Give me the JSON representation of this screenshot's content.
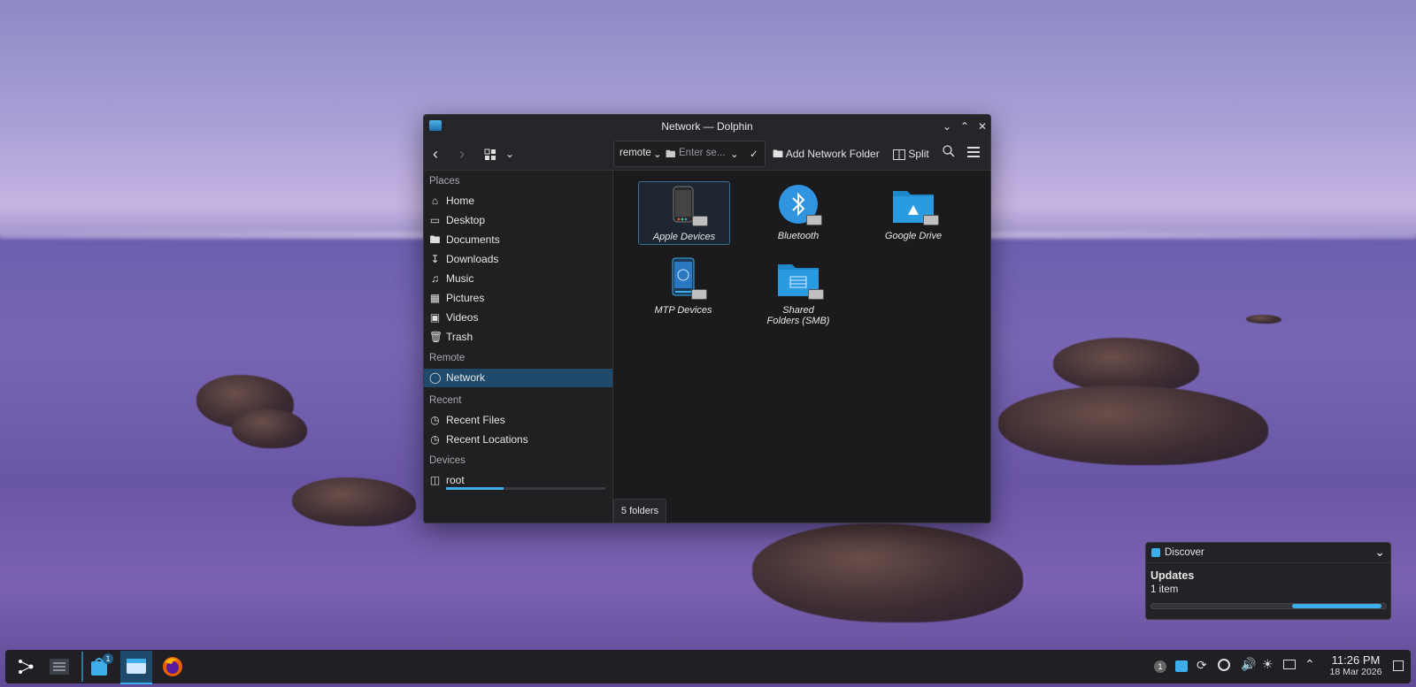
{
  "window": {
    "title": "Network — Dolphin"
  },
  "toolbar": {
    "breadcrumb_root": "remote",
    "location_placeholder": "Enter se...",
    "add_network_folder": "Add Network Folder",
    "split": "Split"
  },
  "sidebar": {
    "sections": [
      {
        "title": "Places"
      },
      {
        "title": "Remote"
      },
      {
        "title": "Recent"
      },
      {
        "title": "Devices"
      }
    ],
    "places": [
      {
        "label": "Home",
        "icon": "home-icon"
      },
      {
        "label": "Desktop",
        "icon": "desktop-icon"
      },
      {
        "label": "Documents",
        "icon": "documents-icon"
      },
      {
        "label": "Downloads",
        "icon": "downloads-icon"
      },
      {
        "label": "Music",
        "icon": "music-icon"
      },
      {
        "label": "Pictures",
        "icon": "pictures-icon"
      },
      {
        "label": "Videos",
        "icon": "videos-icon"
      },
      {
        "label": "Trash",
        "icon": "trash-icon"
      }
    ],
    "remote": [
      {
        "label": "Network",
        "icon": "network-icon",
        "active": true
      }
    ],
    "recent": [
      {
        "label": "Recent Files",
        "icon": "recent-files-icon"
      },
      {
        "label": "Recent Locations",
        "icon": "recent-locations-icon"
      }
    ],
    "devices": [
      {
        "label": "root",
        "icon": "drive-icon",
        "usage": 0.36
      }
    ]
  },
  "folders": [
    {
      "name": "Apple Devices",
      "icon": "phone-icon",
      "selected": true
    },
    {
      "name": "Bluetooth",
      "icon": "bluetooth-icon"
    },
    {
      "name": "Google Drive",
      "icon": "google-drive-icon"
    },
    {
      "name": "MTP Devices",
      "icon": "mtp-device-icon"
    },
    {
      "name": "Shared Folders (SMB)",
      "icon": "smb-folder-icon"
    }
  ],
  "status": {
    "summary": "5 folders"
  },
  "notification": {
    "app": "Discover",
    "title": "Updates",
    "body": "1 item",
    "progress": 0.38
  },
  "taskbar": {
    "discover_badge": "1",
    "tray_badge": "1",
    "time": "11:26 PM",
    "date": "18 Mar 2026"
  },
  "colors": {
    "accent": "#3daee9",
    "selection": "#1f4a6b",
    "window_bg": "#1e1e20"
  }
}
